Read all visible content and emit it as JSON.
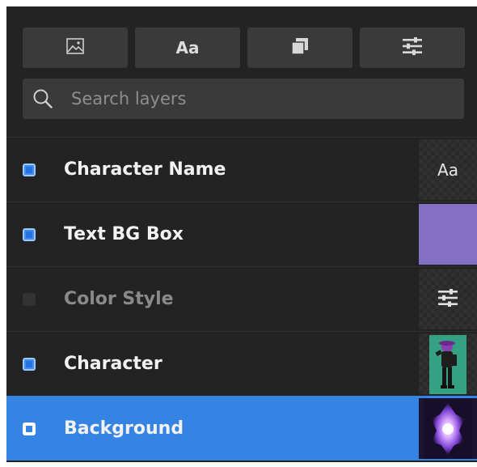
{
  "toolbar": {
    "buttons": [
      {
        "name": "add-image-layer",
        "icon": "image-icon"
      },
      {
        "name": "add-text-layer",
        "icon": "text-icon",
        "label": "Aa"
      },
      {
        "name": "add-shape-layer",
        "icon": "layers-icon"
      },
      {
        "name": "add-adjustment-layer",
        "icon": "sliders-icon"
      }
    ]
  },
  "search": {
    "placeholder": "Search layers",
    "value": ""
  },
  "layers": [
    {
      "name": "Character Name",
      "visible": true,
      "selected": false,
      "thumb": "text",
      "thumb_label": "Aa"
    },
    {
      "name": "Text BG Box",
      "visible": true,
      "selected": false,
      "thumb": "color",
      "thumb_color": "#8470c4"
    },
    {
      "name": "Color Style",
      "visible": false,
      "selected": false,
      "thumb": "sliders-icon"
    },
    {
      "name": "Character",
      "visible": true,
      "selected": false,
      "thumb": "image-character"
    },
    {
      "name": "Background",
      "visible": true,
      "selected": true,
      "thumb": "image-background"
    }
  ],
  "colors": {
    "panel": "#232323",
    "button": "#3a3a3a",
    "selected_row": "#3584e4",
    "checkbox_on": "#3d8ef0",
    "text_bg_box": "#8470c4"
  }
}
